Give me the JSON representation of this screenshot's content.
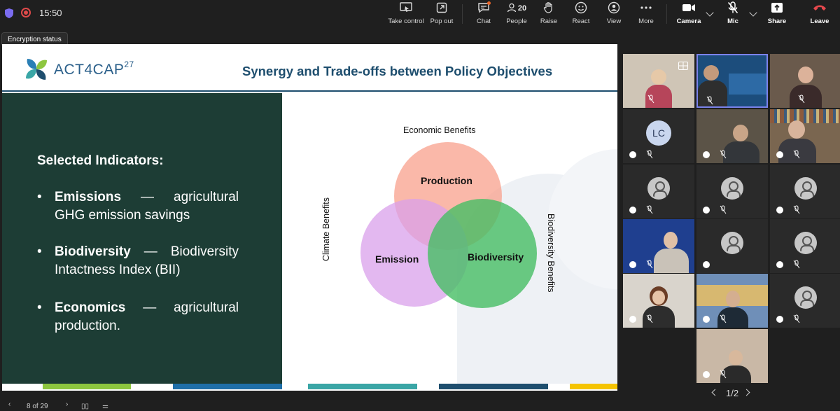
{
  "topbar": {
    "time": "15:50",
    "take_control": "Take control",
    "pop_out": "Pop out",
    "chat": "Chat",
    "people_count": "20",
    "people": "People",
    "raise": "Raise",
    "react": "React",
    "view": "View",
    "more": "More",
    "camera": "Camera",
    "mic": "Mic",
    "share": "Share",
    "leave": "Leave"
  },
  "tooltip": "Encryption status",
  "slide": {
    "logo": "ACT4CAP",
    "logo_sup": "27",
    "title": "Synergy and Trade-offs between Policy Objectives",
    "heading": "Selected Indicators:",
    "bullets": [
      {
        "term": "Emissions",
        "dash": "—",
        "rest1": "agricultural",
        "line2": "GHG emission savings"
      },
      {
        "term": "Biodiversity",
        "dash": "—",
        "rest1": "Biodiversity",
        "line2": "Intactness Index (BII)"
      },
      {
        "term": "Economics",
        "dash": "—",
        "rest1": "agricultural",
        "line2": "production."
      }
    ],
    "venn": {
      "top_label": "Economic Benefits",
      "left_label": "Climate Benefits",
      "right_label": "Biodiversity Benefits",
      "production": "Production",
      "emission": "Emission",
      "biodiversity": "Biodiversity"
    },
    "footer_colors": [
      "#8dc63f",
      "#1f6fa8",
      "#3aa6a6",
      "#1e4e6e",
      "#f5c400"
    ]
  },
  "bottom": {
    "page": "8 of 29"
  },
  "gallery": {
    "avatar_lc": "LC",
    "pager": "1/2"
  }
}
